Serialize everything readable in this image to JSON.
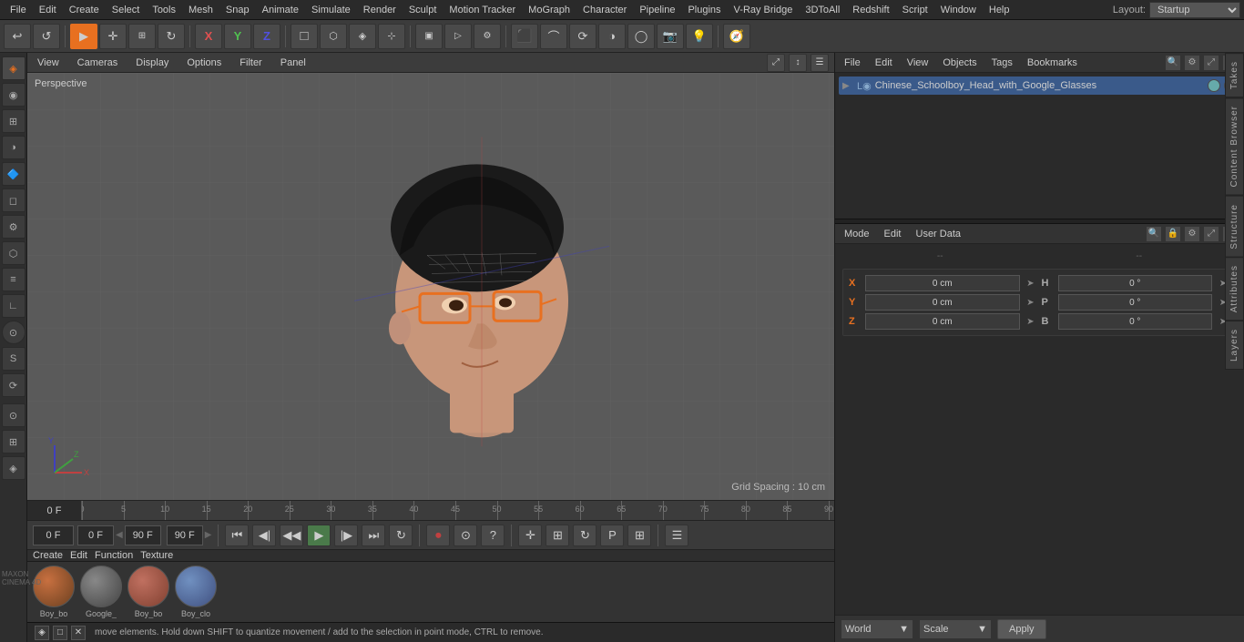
{
  "menubar": {
    "items": [
      "File",
      "Edit",
      "Create",
      "Select",
      "Tools",
      "Mesh",
      "Snap",
      "Animate",
      "Simulate",
      "Render",
      "Sculpt",
      "Motion Tracker",
      "MoGraph",
      "Character",
      "Pipeline",
      "Plugins",
      "V-Ray Bridge",
      "3DToAll",
      "Redshift",
      "Script",
      "Window",
      "Help"
    ],
    "layout_label": "Layout:",
    "layout_value": "Startup"
  },
  "toolbar": {
    "undo_icon": "↩",
    "redo_icon": "↺",
    "select_icon": "▶",
    "move_icon": "✛",
    "scale_icon": "⊞",
    "rotate_icon": "↻",
    "x_icon": "X",
    "y_icon": "Y",
    "z_icon": "Z",
    "object_icon": "□",
    "play_icon": "▶",
    "record_icon": "⏺",
    "camera_icon": "📷"
  },
  "viewport": {
    "label": "Perspective",
    "menus": [
      "View",
      "Cameras",
      "Display",
      "Options",
      "Filter",
      "Panel"
    ],
    "grid_spacing": "Grid Spacing : 10 cm"
  },
  "timeline": {
    "ticks": [
      0,
      5,
      10,
      15,
      20,
      25,
      30,
      35,
      40,
      45,
      50,
      55,
      60,
      65,
      70,
      75,
      80,
      85,
      90
    ],
    "current_frame": "0 F",
    "start_frame": "0 F",
    "end_frame": "90 F",
    "preview_end": "90 F"
  },
  "transport": {
    "frame_field": "0 F",
    "start_field": "0 F",
    "end_field": "90 F",
    "preview_field": "90 F"
  },
  "materials": {
    "header_items": [
      "Create",
      "Edit",
      "Function",
      "Texture"
    ],
    "items": [
      {
        "name": "Boy_bo",
        "color1": "#c87040",
        "color2": "#6b4020"
      },
      {
        "name": "Google_",
        "color1": "#888",
        "color2": "#444"
      },
      {
        "name": "Boy_bo",
        "color1": "#c07060",
        "color2": "#804030"
      },
      {
        "name": "Boy_clo",
        "color1": "#7090c0",
        "color2": "#405080"
      }
    ]
  },
  "status": {
    "text": "move elements. Hold down SHIFT to quantize movement / add to the selection in point mode, CTRL to remove."
  },
  "right_panel": {
    "file_menus": [
      "File",
      "Edit",
      "View",
      "Objects",
      "Tags",
      "Bookmarks"
    ],
    "object_tree": [
      {
        "label": "Chinese_Schoolboy_Head_with_Google_Glasses",
        "icon": "L",
        "level": 0
      }
    ],
    "attr_menus": [
      "Mode",
      "Edit",
      "User Data"
    ],
    "coord_sep_left": "--",
    "coord_sep_right": "--",
    "coords": {
      "X_pos": "0 cm",
      "Y_pos": "0 cm",
      "Z_pos": "0 cm",
      "X_rot": "0 °",
      "Y_rot": "0 °",
      "Z_rot": "0 °",
      "H": "0 °",
      "P": "0 °",
      "B": "0 °"
    },
    "bottom": {
      "world_label": "World",
      "scale_label": "Scale",
      "apply_label": "Apply"
    }
  },
  "side_panel_tabs": [
    "Takes",
    "Content Browser",
    "Structure",
    "Attributes",
    "Layers"
  ],
  "maxon": {
    "line1": "MAXON",
    "line2": "CINEMA 4D"
  }
}
